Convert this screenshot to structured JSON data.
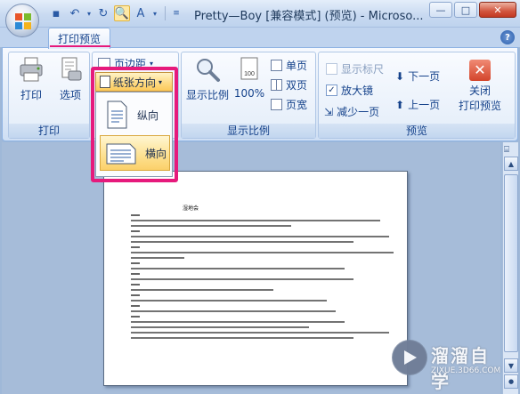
{
  "window": {
    "title": "Pretty—Boy [兼容模式] (预览) - Microso...",
    "minimize": "—",
    "maximize": "□",
    "close": "✕"
  },
  "qat": {
    "icons": [
      "save-icon",
      "undo-icon",
      "redo-icon",
      "print-preview-icon",
      "text-style-icon"
    ]
  },
  "tabs": {
    "active": "打印预览"
  },
  "ribbon": {
    "print_group": {
      "label": "打印",
      "print": "打印",
      "options": "选项"
    },
    "page_setup_group": {
      "margins": "页边距",
      "orientation": "纸张方向"
    },
    "zoom_group": {
      "label": "显示比例",
      "zoom": "显示比例",
      "hundred": "100%",
      "one_page": "单页",
      "two_pages": "双页",
      "page_width": "页宽"
    },
    "preview_group": {
      "label": "预览",
      "show_ruler": "显示标尺",
      "magnifier": "放大镜",
      "shrink_one_page": "减少一页",
      "next_page": "下一页",
      "prev_page": "上一页",
      "close_preview": "关闭\n打印预览",
      "close_line1": "关闭",
      "close_line2": "打印预览",
      "show_ruler_checked": false,
      "magnifier_checked": true
    }
  },
  "orientation_menu": {
    "portrait": "纵向",
    "landscape": "横向",
    "selected": "landscape"
  },
  "document": {
    "title": "湿地会"
  },
  "watermark": {
    "brand": "溜溜自学",
    "url": "ZIXUE.3D66.COM"
  },
  "colors": {
    "highlight": "#e61a7c",
    "accent": "#15428b"
  }
}
